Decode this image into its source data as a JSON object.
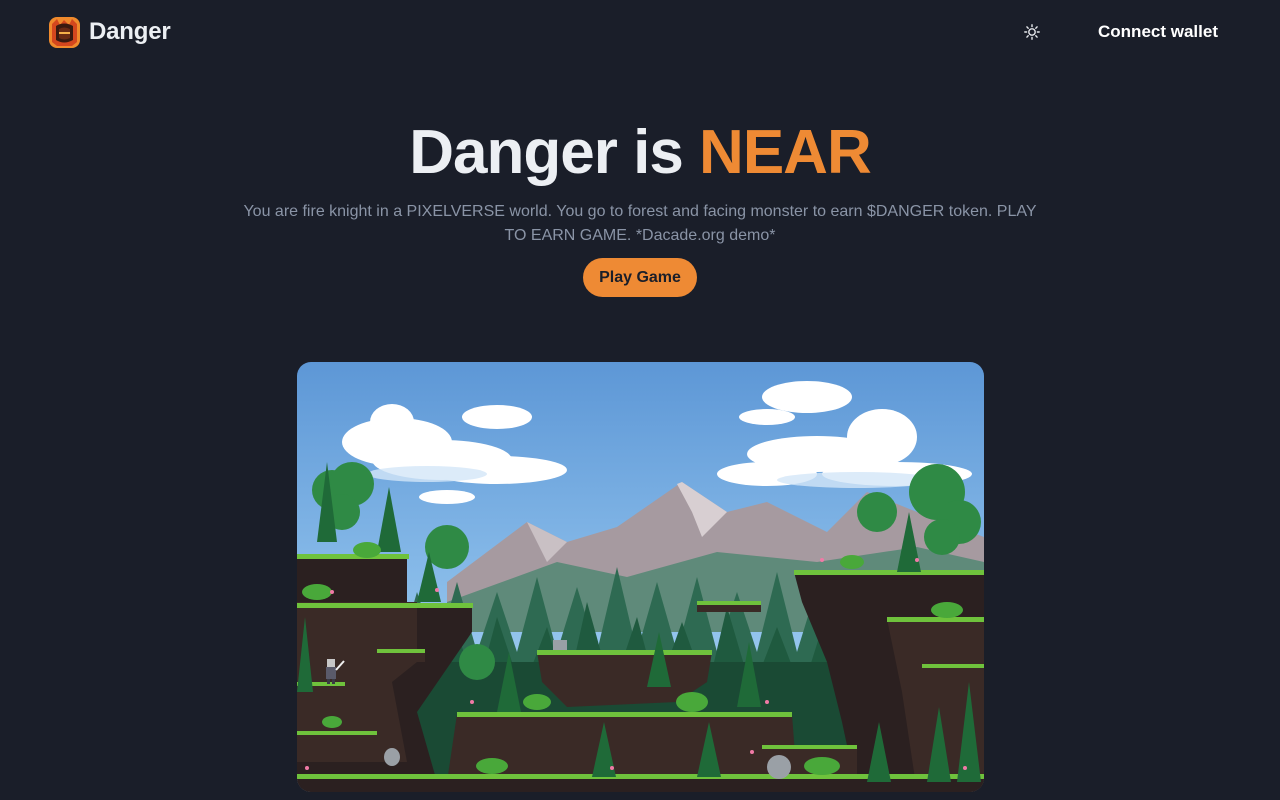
{
  "brand": {
    "name": "Danger",
    "logo_icon": "fire-knight-helmet-icon"
  },
  "nav": {
    "theme_icon": "sun-icon",
    "connect_label": "Connect wallet"
  },
  "hero": {
    "title_prefix": "Danger is",
    "title_accent": "NEAR",
    "description": "You are fire knight in a PIXELVERSE world. You go to forest and facing monster to earn $DANGER token. PLAY TO EARN GAME. *Dacade.org demo*",
    "cta_label": "Play Game"
  },
  "colors": {
    "background": "#1a1e29",
    "accent": "#ee8a34",
    "muted_text": "#8a94a6"
  }
}
